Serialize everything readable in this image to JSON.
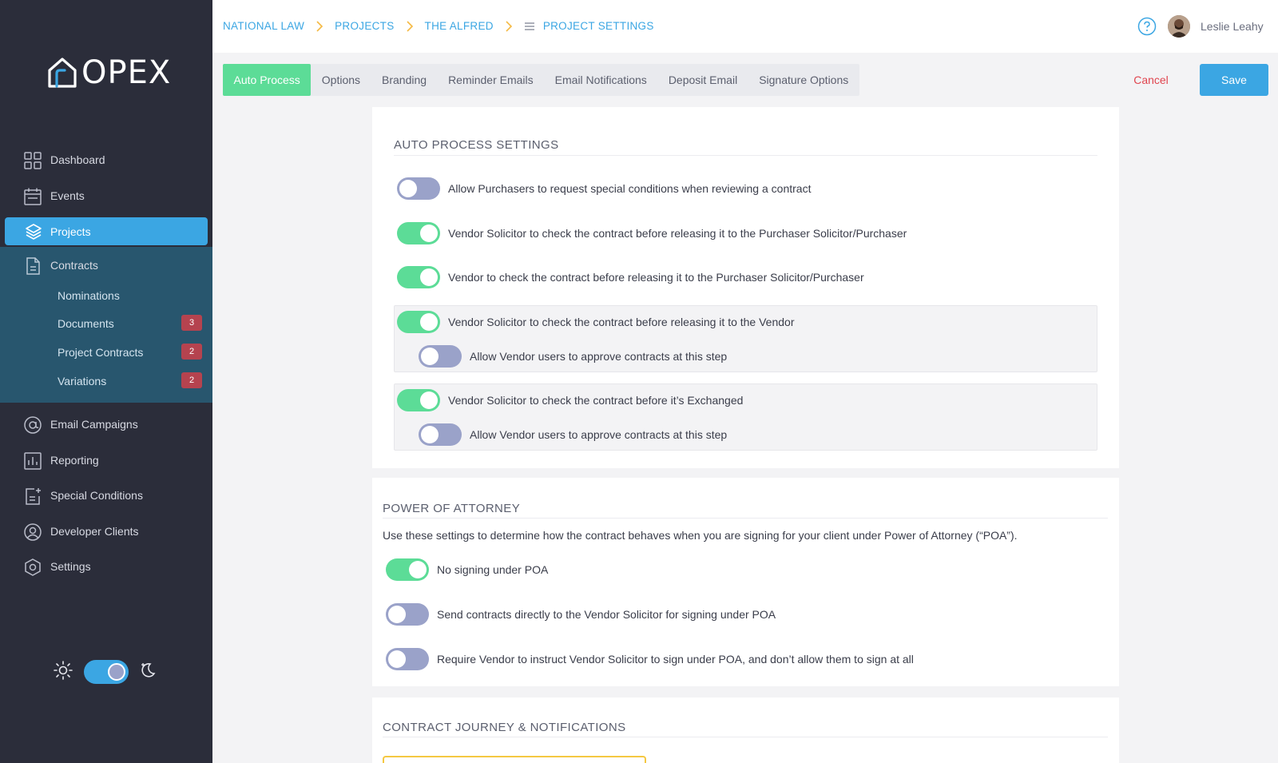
{
  "app": {
    "logo_text": "OPEX"
  },
  "sidebar": {
    "items": [
      {
        "label": "Dashboard",
        "icon": "grid-icon"
      },
      {
        "label": "Events",
        "icon": "calendar-icon"
      },
      {
        "label": "Projects",
        "icon": "layers-icon",
        "active": true
      },
      {
        "label": "Contracts",
        "icon": "document-icon"
      },
      {
        "label": "Email Campaigns",
        "icon": "at-sign-icon"
      },
      {
        "label": "Reporting",
        "icon": "bar-chart-icon"
      },
      {
        "label": "Special Conditions",
        "icon": "document-plus-icon"
      },
      {
        "label": "Developer Clients",
        "icon": "user-circle-icon"
      },
      {
        "label": "Settings",
        "icon": "hexagon-gear-icon"
      }
    ],
    "contracts_sub": [
      {
        "label": "Nominations",
        "badge": null
      },
      {
        "label": "Documents",
        "badge": "3"
      },
      {
        "label": "Project Contracts",
        "badge": "2"
      },
      {
        "label": "Variations",
        "badge": "2"
      }
    ],
    "theme": {
      "dark_mode": true
    }
  },
  "header": {
    "breadcrumb": [
      "NATIONAL LAW",
      "PROJECTS",
      "THE ALFRED",
      "PROJECT SETTINGS"
    ],
    "user_name": "Leslie Leahy"
  },
  "tabs": [
    "Auto Process",
    "Options",
    "Branding",
    "Reminder Emails",
    "Email Notifications",
    "Deposit Email",
    "Signature Options"
  ],
  "actions": {
    "cancel": "Cancel",
    "save": "Save"
  },
  "auto_process": {
    "title": "AUTO PROCESS SETTINGS",
    "settings": [
      {
        "label": "Allow Purchasers to request special conditions when reviewing a contract",
        "on": false
      },
      {
        "label": "Vendor Solicitor to check the contract before releasing it to the Purchaser Solicitor/Purchaser",
        "on": true
      },
      {
        "label": "Vendor to check the contract before releasing it to the Purchaser Solicitor/Purchaser",
        "on": true
      },
      {
        "label": "Vendor Solicitor to check the contract before releasing it to the Vendor",
        "on": true
      },
      {
        "label": "Allow Vendor users to approve contracts at this step",
        "on": false
      },
      {
        "label": "Vendor Solicitor to check the contract before it’s Exchanged",
        "on": true
      },
      {
        "label": "Allow Vendor users to approve contracts at this step",
        "on": false
      }
    ]
  },
  "poa": {
    "title": "POWER OF ATTORNEY",
    "description": "Use these settings to determine how the contract behaves when you are signing for your client under Power of Attorney (“POA”).",
    "settings": [
      {
        "label": "No signing under POA",
        "on": true
      },
      {
        "label": "Send contracts directly to the Vendor Solicitor for signing under POA",
        "on": false
      },
      {
        "label": "Require Vendor to instruct Vendor Solicitor to sign under POA, and don’t allow them to sign at all",
        "on": false
      }
    ]
  },
  "journey": {
    "title": "CONTRACT JOURNEY & NOTIFICATIONS"
  },
  "colors": {
    "accent": "#3ba6e3",
    "toggle_on": "#5cdc97",
    "toggle_off": "#9aa2c9",
    "sidebar_bg": "#2b2d3a",
    "danger": "#e0454f"
  }
}
